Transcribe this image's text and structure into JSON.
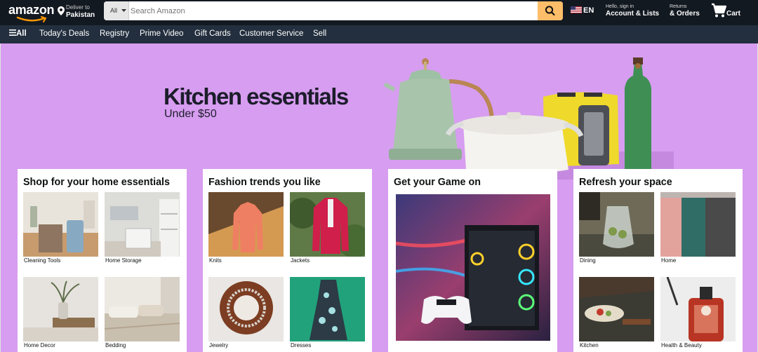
{
  "header": {
    "logo_text": "amazon",
    "deliver_line1": "Deliver to",
    "deliver_line2": "Pakistan",
    "search_category": "All",
    "search_placeholder": "Search Amazon",
    "language": "EN",
    "account_line1": "Hello, sign in",
    "account_line2": "Account & Lists",
    "returns_line1": "Returns",
    "returns_line2": "& Orders",
    "cart_label": "Cart",
    "colors": {
      "bar": "#131921",
      "search_button": "#febd69",
      "logo_smile": "#ff9900"
    }
  },
  "subnav": {
    "all_label": "All",
    "items": [
      "Today's Deals",
      "Registry",
      "Prime Video",
      "Gift Cards",
      "Customer Service",
      "Sell"
    ]
  },
  "hero": {
    "title": "Kitchen essentials",
    "subtitle": "Under $50",
    "background": "#d79df0"
  },
  "cards": [
    {
      "title": "Shop for your home essentials",
      "tiles": [
        "Cleaning Tools",
        "Home Storage",
        "Home Decor",
        "Bedding"
      ]
    },
    {
      "title": "Fashion trends you like",
      "tiles": [
        "Knits",
        "Jackets",
        "Jewelry",
        "Dresses"
      ]
    },
    {
      "title": "Get your Game on"
    },
    {
      "title": "Refresh your space",
      "tiles": [
        "Dining",
        "Home",
        "Kitchen",
        "Health & Beauty"
      ]
    }
  ],
  "icons": [
    "location-pin-icon",
    "chevron-down-icon",
    "search-icon",
    "us-flag-icon",
    "cart-icon",
    "hamburger-menu-icon"
  ]
}
